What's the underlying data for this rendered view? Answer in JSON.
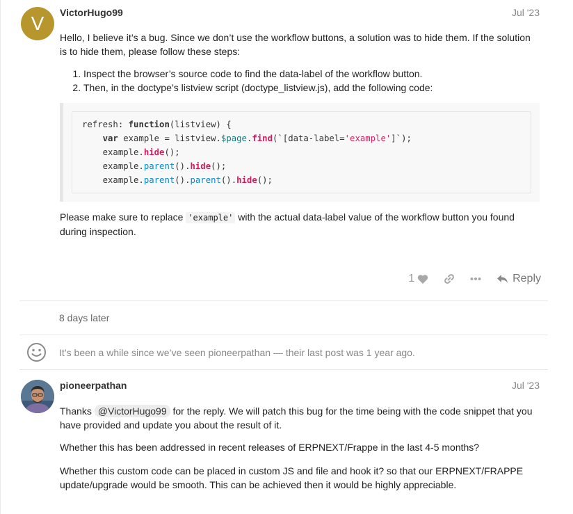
{
  "post1": {
    "avatar_letter": "V",
    "username": "VictorHugo99",
    "date": "Jul '23",
    "intro": "Hello, I believe it’s a bug. Since we don’t use the workflow buttons, a solution was to hide them. If the solution is to hide them, please follow these steps:",
    "steps": [
      "Inspect the browser’s source code to find the data-label of the workflow button.",
      "Then, in the doctype’s listview script (doctype_listview.js), add the following code:"
    ],
    "outro_before": "Please make sure to replace ",
    "outro_code": "'example'",
    "outro_after": " with the actual data-label value of the workflow button you found during inspection.",
    "likes": "1",
    "reply_label": "Reply",
    "colors": {
      "avatar": "#b7962e",
      "like": "#9a9a9a"
    }
  },
  "time_gap": "8 days later",
  "absence_notice": "It’s been a while since we’ve seen pioneerpathan — their last post was 1 year ago.",
  "post2": {
    "username": "pioneerpathan",
    "date": "Jul '23",
    "p1_before": "Thanks ",
    "mention": "@VictorHugo99",
    "p1_after": " for the reply. We will patch this bug for the time being with the code snippet that you have provided and update you about the result of it.",
    "p2": "Whether this has been addressed in recent releases of ERPNEXT/Frappe in the last 4-5 months?",
    "p3": "Whether this custom code can be placed in custom JS and file and hook it? so that our ERPNEXT/FRAPPE update/upgrade would be smooth. This can be achieved then it would be highly appreciable."
  },
  "icons": [
    "heart-icon",
    "link-icon",
    "more-icon",
    "reply-icon",
    "smile-icon"
  ]
}
